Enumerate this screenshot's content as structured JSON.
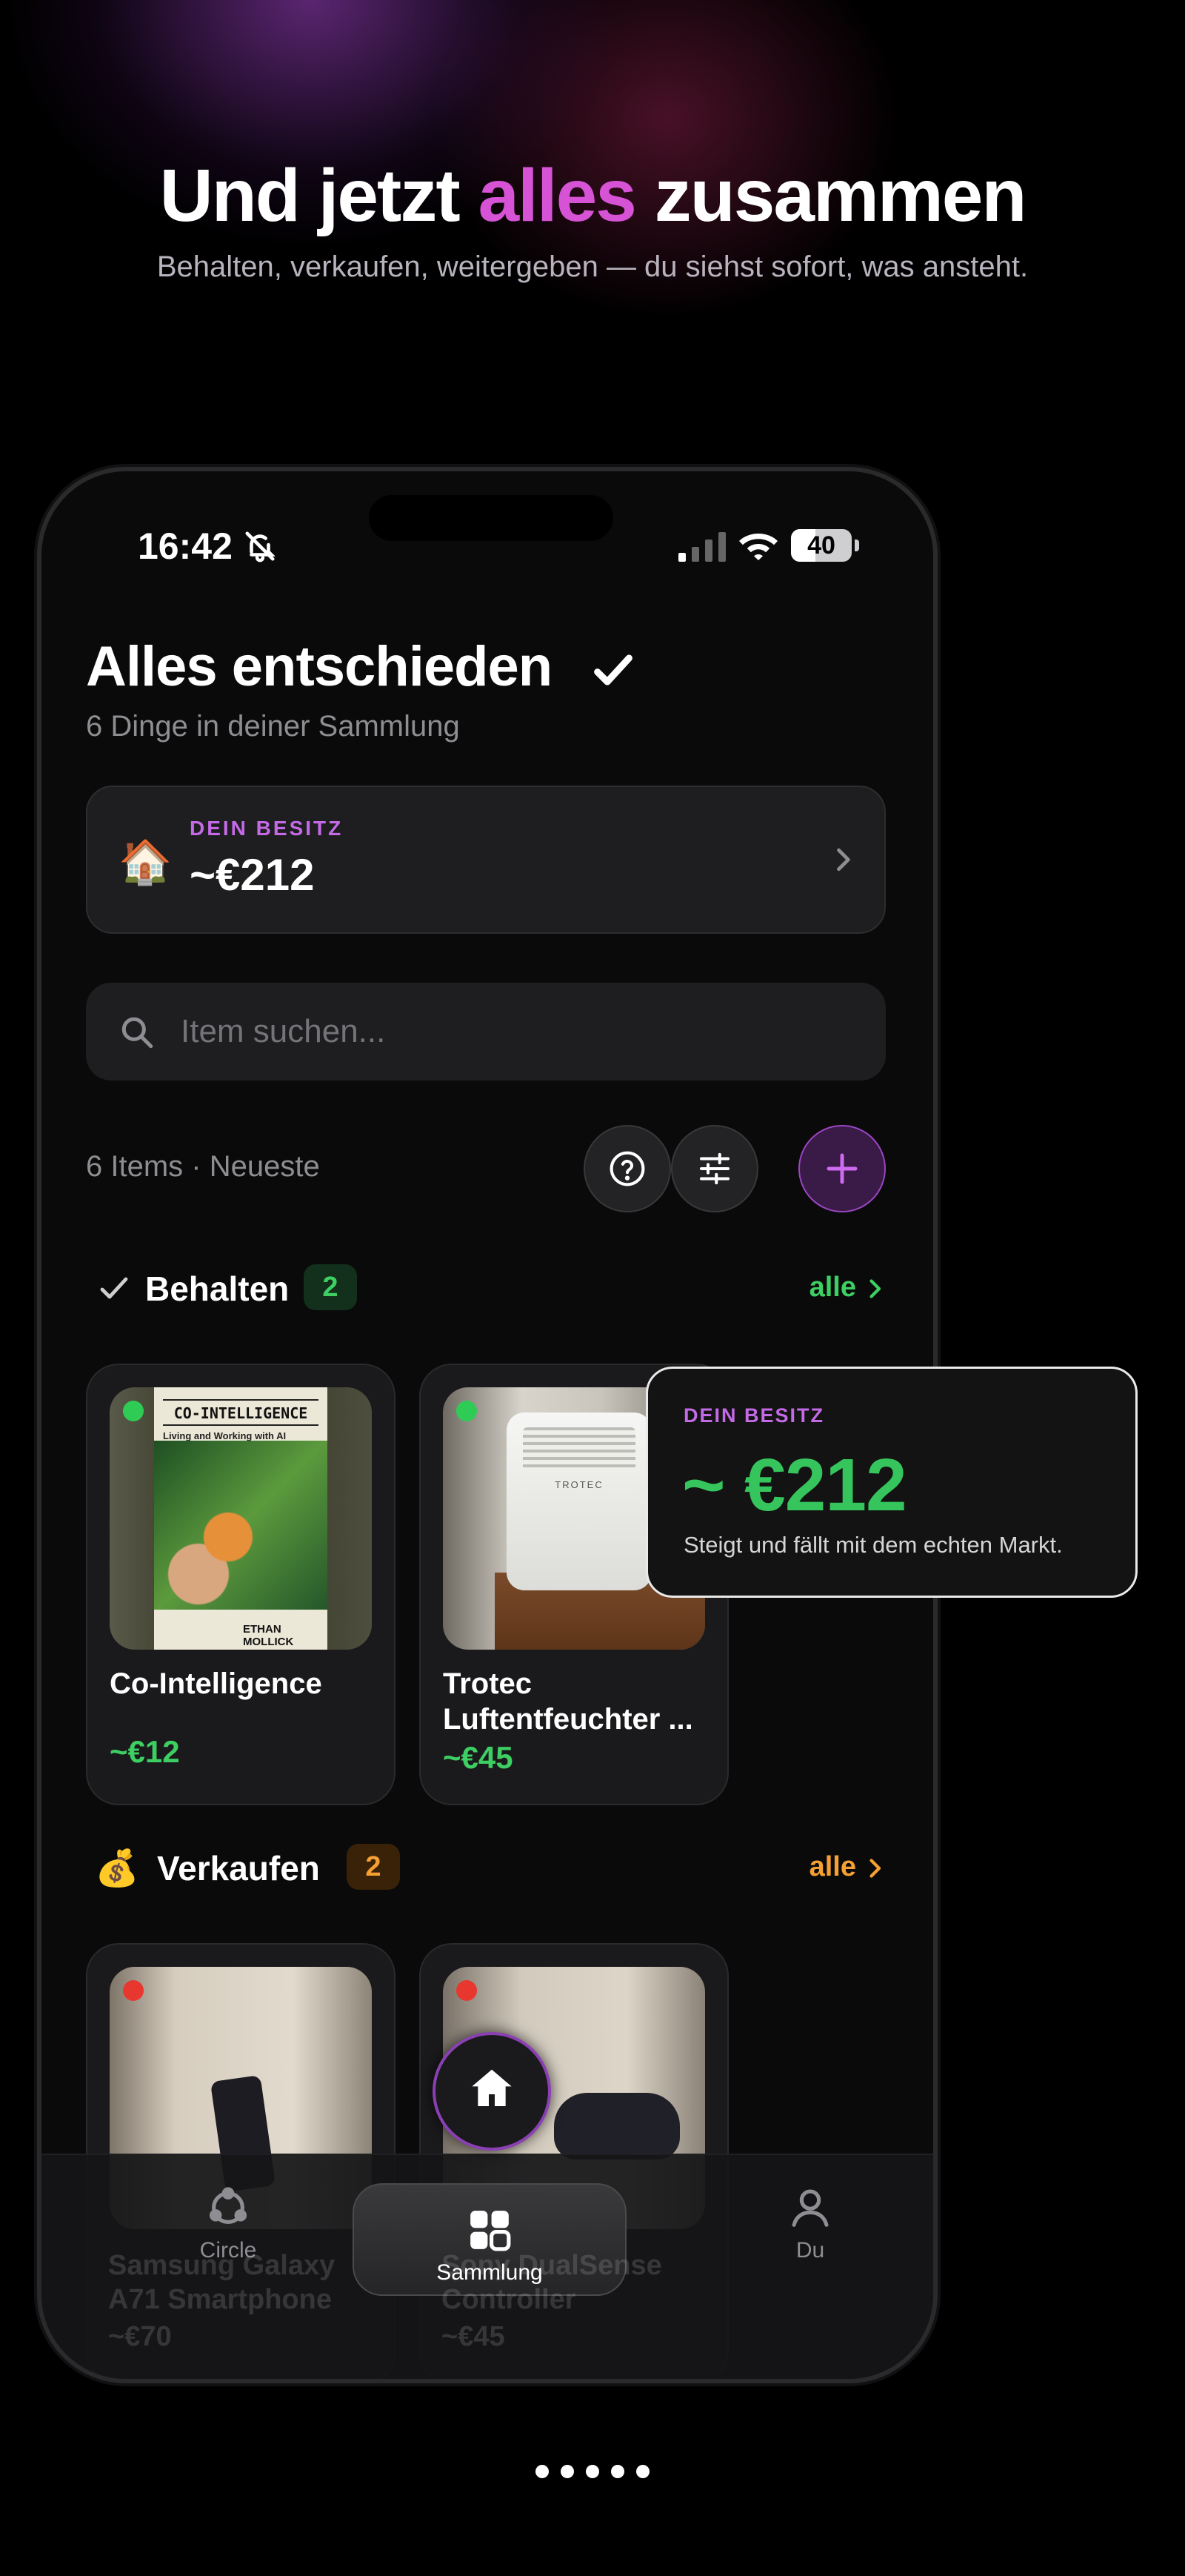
{
  "headline": {
    "before": "Und jetzt ",
    "accent": "alles",
    "after": " zusammen"
  },
  "subline": "Behalten, verkaufen, weitergeben — du siehst sofort, was ansteht.",
  "status_bar": {
    "time": "16:42",
    "battery": "40"
  },
  "page": {
    "title": "Alles entschieden",
    "subtitle": "6 Dinge in deiner Sammlung"
  },
  "possession": {
    "icon": "house-emoji",
    "label": "DEIN BESITZ",
    "value": "~€212"
  },
  "search": {
    "placeholder": "Item suchen..."
  },
  "toolbar": {
    "count_label": "6 Items · Neueste"
  },
  "sections": {
    "keep": {
      "title": "Behalten",
      "count": "2",
      "link": "alle"
    },
    "sell": {
      "title": "Verkaufen",
      "count": "2",
      "link": "alle"
    }
  },
  "keep_items": [
    {
      "name": "Co-Intelligence",
      "price": "~€12",
      "cover_title": "CO-INTELLIGENCE",
      "cover_subtitle": "Living and Working with AI",
      "cover_author": "ETHAN MOLLICK"
    },
    {
      "name": "Trotec Luftentfeuchter ...",
      "price": "~€45",
      "brand": "TROTEC"
    }
  ],
  "sell_items": [
    {
      "name": "Samsung Galaxy A71 Smartphone",
      "price": "~€70"
    },
    {
      "name": "Sony DualSense Controller",
      "price": "~€45"
    }
  ],
  "tooltip": {
    "label": "DEIN BESITZ",
    "value": "~ €212",
    "description": "Steigt und fällt mit dem echten Markt."
  },
  "tabs": [
    {
      "label": "Circle",
      "icon": "circle-share-icon"
    },
    {
      "label": "Sammlung",
      "icon": "grid-icon"
    },
    {
      "label": "Du",
      "icon": "person-icon"
    }
  ],
  "colors": {
    "accent_purple": "#c46ae6",
    "green": "#3ecf63",
    "orange": "#f5a032",
    "headline_pink": "#d653d6"
  },
  "pager": {
    "count": 5
  }
}
